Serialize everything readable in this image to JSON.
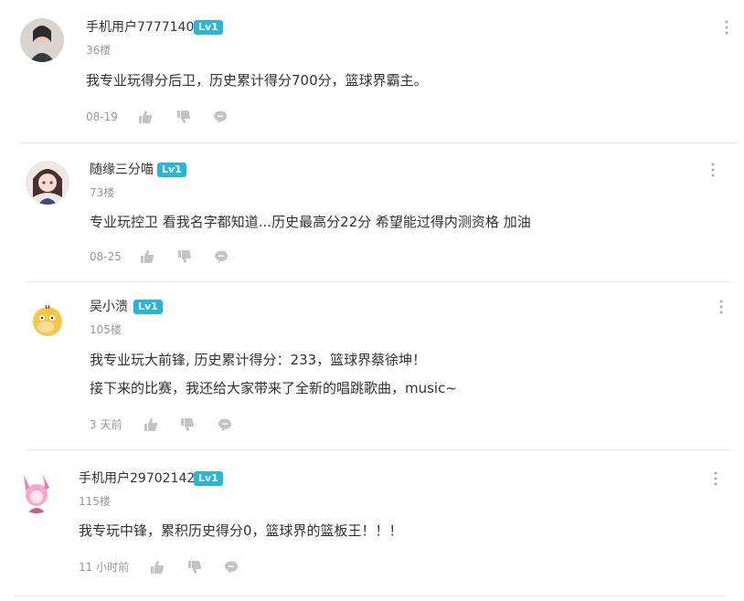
{
  "comments": [
    {
      "username": "手机用户7777140",
      "level": "Lv1",
      "floor": "36楼",
      "lines": [
        "我专业玩得分后卫，历史累计得分700分，篮球界霸主。"
      ],
      "time": "08-19"
    },
    {
      "username": "随缘三分喵",
      "level": "Lv1",
      "floor": "73楼",
      "lines": [
        "专业玩控卫 看我名字都知道...历史最高分22分 希望能过得内测资格 加油"
      ],
      "time": "08-25"
    },
    {
      "username": "吴小溃",
      "level": "Lv1",
      "floor": "105楼",
      "lines": [
        "我专业玩大前锋, 历史累计得分：233，篮球界蔡徐坤！",
        "接下来的比赛，我还给大家带来了全新的唱跳歌曲，music~"
      ],
      "time": "3 天前"
    },
    {
      "username": "手机用户29702142",
      "level": "Lv1",
      "floor": "115楼",
      "lines": [
        "我专玩中锋，累积历史得分0，篮球界的篮板王！！！"
      ],
      "time": "11 小时前"
    }
  ],
  "colors": {
    "level_badge": "#29b6d6",
    "muted_text": "#999999",
    "main_text": "#333333",
    "divider": "#e6e6e6"
  },
  "icons": [
    "like-icon",
    "dislike-icon",
    "reply-icon",
    "more-icon"
  ]
}
